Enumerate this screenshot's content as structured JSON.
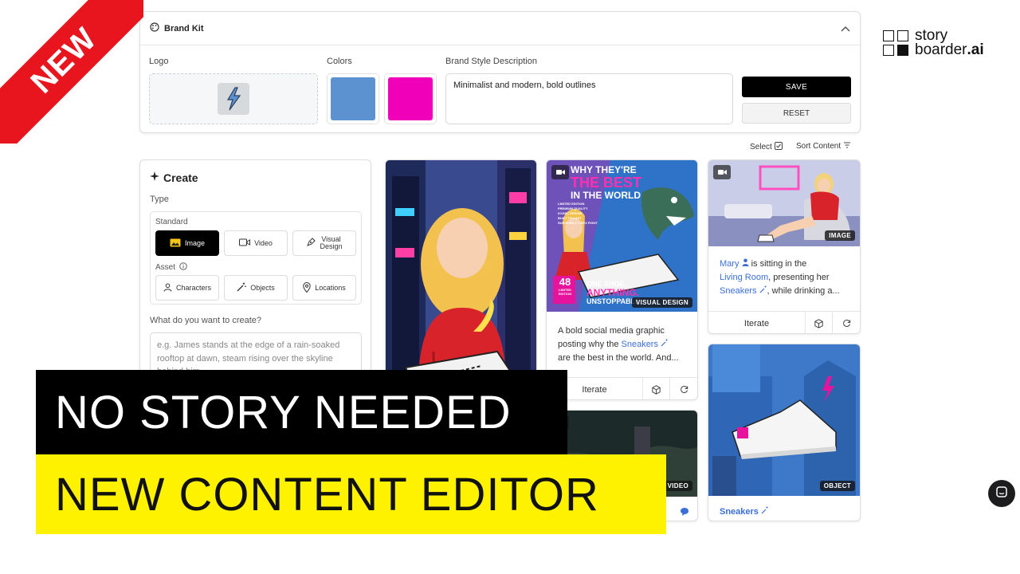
{
  "ribbon": {
    "label": "NEW"
  },
  "brand_kit": {
    "title": "Brand Kit",
    "logo_label": "Logo",
    "colors_label": "Colors",
    "colors": [
      "#5b92cf",
      "#f000b8"
    ],
    "description_label": "Brand Style Description",
    "description_value": "Minimalist and modern, bold outlines",
    "save_label": "SAVE",
    "reset_label": "RESET"
  },
  "logo": {
    "line1": "story",
    "line2_a": "boarder",
    "line2_b": ".ai"
  },
  "toolbar": {
    "select_label": "Select",
    "sort_label": "Sort Content"
  },
  "create": {
    "title": "Create",
    "type_label": "Type",
    "standard_label": "Standard",
    "asset_label": "Asset",
    "buttons": {
      "image": "Image",
      "video": "Video",
      "visual_design_1": "Visual",
      "visual_design_2": "Design",
      "characters": "Characters",
      "objects": "Objects",
      "locations": "Locations"
    },
    "prompt_label": "What do you want to create?",
    "prompt_placeholder": "e.g. James stands at the edge of a rain-soaked rooftop at dawn, steam rising over the skyline behind him"
  },
  "cards": {
    "design": {
      "badge": "VISUAL DESIGN",
      "text_1": "A bold social media graphic",
      "text_2a": "posting why the ",
      "text_2_link": "Sneakers",
      "text_3": "are the best in the world. And...",
      "iterate": "Iterate",
      "poster_title_1": "WHY THEY'RE",
      "poster_title_2": "THE BEST",
      "poster_title_3": "IN THE WORLD",
      "poster_bullets": [
        "LIMITED EDITION",
        "PREMIUM QUALITY",
        "ICONIC DESIGN",
        "BUILT TO LAST",
        "SURVIVES A T-REX FIGHT"
      ],
      "poster_num": "48",
      "poster_num_sub": "LIMITED EDITION",
      "poster_tag_1": "ONE SHOE.",
      "poster_tag_2": "ANYTHING.",
      "poster_tag_3": "UNSTOPPABLE."
    },
    "room": {
      "badge": "IMAGE",
      "name": "Mary",
      "t1": " is sitting in the",
      "place": "Living Room",
      "t2": ", presenting her",
      "item": "Sneakers",
      "t3": ", while drinking a...",
      "iterate": "Iterate"
    },
    "video": {
      "badge": "VIDEO"
    },
    "object": {
      "badge": "OBJECT",
      "name": "Sneakers"
    }
  },
  "banners": {
    "line1": "NO STORY NEEDED",
    "line2": "NEW CONTENT EDITOR"
  }
}
